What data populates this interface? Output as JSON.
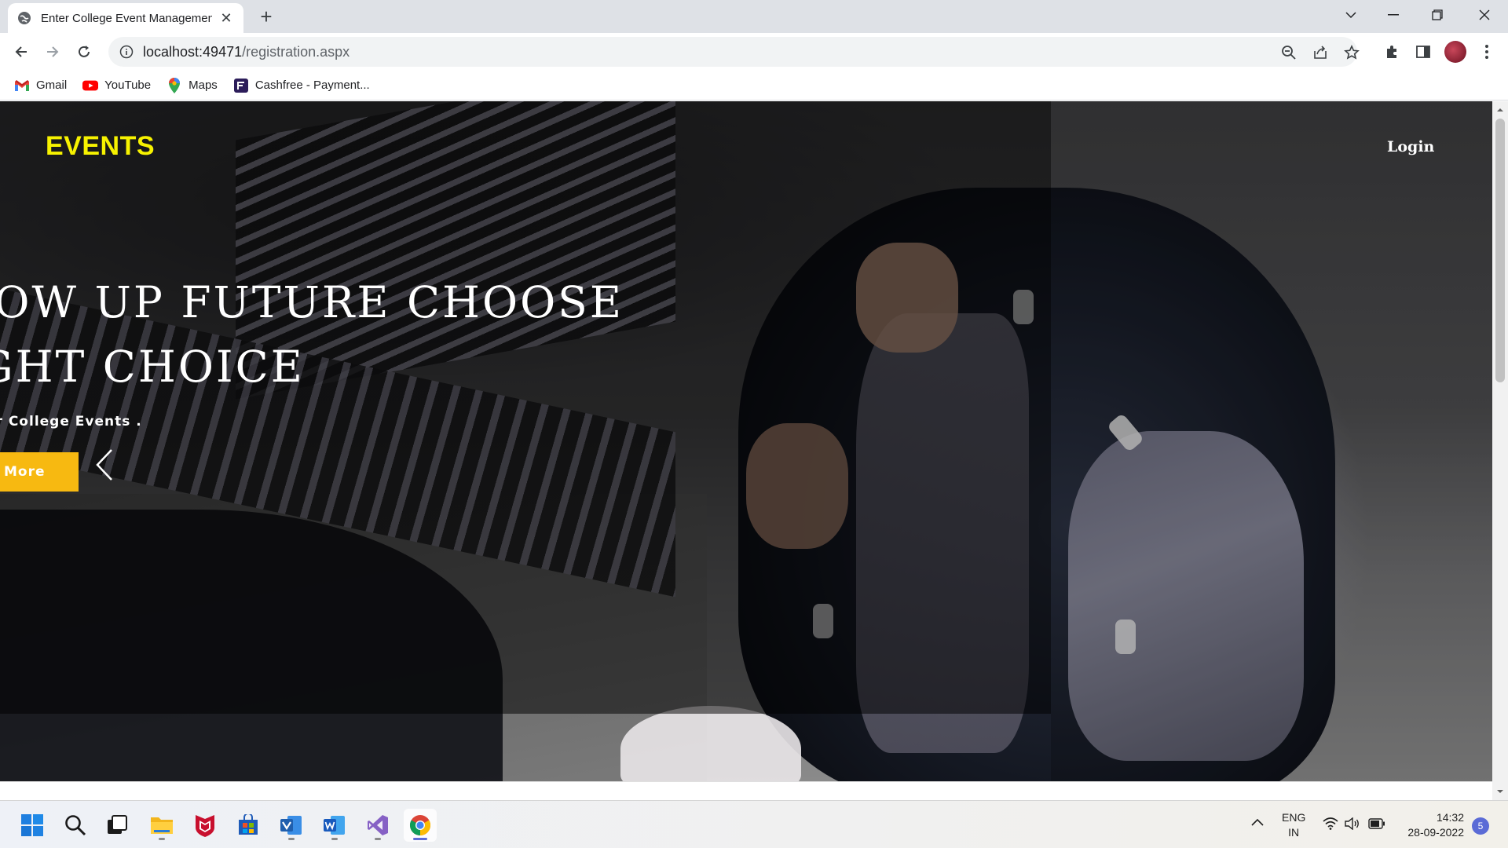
{
  "browser": {
    "tab": {
      "title": "Enter College Event Management",
      "close_glyph": "✕"
    },
    "new_tab_glyph": "+",
    "window_controls": {
      "tablist_glyph": "⌄",
      "minimize_glyph": "—",
      "restore_glyph": "❐",
      "close_glyph": "✕"
    },
    "url": {
      "host": "localhost:49471",
      "path": "/registration.aspx"
    },
    "bookmarks": [
      {
        "label": "Gmail",
        "icon": "gmail-icon"
      },
      {
        "label": "YouTube",
        "icon": "youtube-icon"
      },
      {
        "label": "Maps",
        "icon": "maps-icon"
      },
      {
        "label": "Cashfree - Payment...",
        "icon": "cashfree-icon"
      }
    ]
  },
  "page": {
    "logo": "EVENTS",
    "login_label": "Login",
    "headline_line1": "ROW UP FUTURE CHOOSE",
    "headline_line2": "IGHT CHOICE",
    "subline": "er College Events .",
    "read_more_label": "ad More",
    "accent_color": "#f7b911",
    "logo_color": "#f7f200"
  },
  "taskbar": {
    "apps": [
      "windows-start-icon",
      "search-icon",
      "task-view-icon",
      "file-explorer-icon",
      "mcafee-icon",
      "microsoft-store-icon",
      "visio-icon",
      "word-icon",
      "visual-studio-icon",
      "chrome-icon"
    ],
    "lang_line1": "ENG",
    "lang_line2": "IN",
    "time": "14:32",
    "date": "28-09-2022",
    "notification_count": "5"
  }
}
